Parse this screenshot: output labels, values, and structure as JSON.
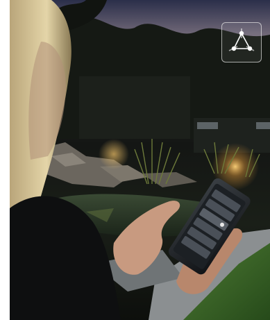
{
  "image": {
    "description_colors": {
      "sky_top": "#2a2d45",
      "sky_dusk": "#7a6f78",
      "foliage": "#1a1f18",
      "lamp_glow": "#f2b64a",
      "pond": "#2b3a30",
      "lawn": "#3f6a2a",
      "patio": "#8b8f91",
      "hair": "#d8c79a"
    },
    "logo_icon": "triangle-nodes-icon"
  }
}
